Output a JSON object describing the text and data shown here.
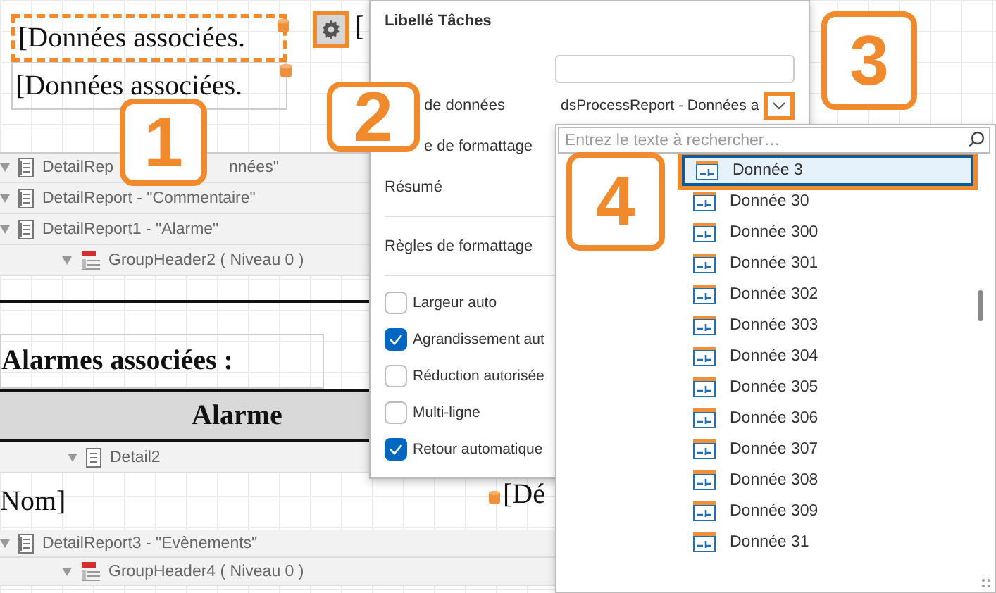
{
  "designer": {
    "fields": [
      {
        "text": "[Données associées.",
        "selected": true
      },
      {
        "text": "[Données associées.",
        "selected": false
      }
    ],
    "clipped_field": "[",
    "bands": [
      {
        "kind": "detail_report",
        "label": "DetailRep",
        "label_after": "nnées\""
      },
      {
        "kind": "detail_report",
        "label": "DetailReport - \"Commentaire\""
      },
      {
        "kind": "detail_report",
        "label": "DetailReport1 - \"Alarme\""
      },
      {
        "kind": "group_header",
        "label": "GroupHeader2 ( Niveau 0 )"
      }
    ],
    "section_title": "Alarmes associées :",
    "table_header": "Alarme",
    "detail_band": {
      "kind": "detail",
      "label": "Detail2"
    },
    "detail_fields": [
      "Nom]",
      "[Dé"
    ],
    "bottom_bands": [
      {
        "kind": "detail_report",
        "label": "DetailReport3 - \"Evènements\""
      },
      {
        "kind": "group_header",
        "label": "GroupHeader4 ( Niveau 0 )"
      }
    ]
  },
  "panel": {
    "title": "Libellé Tâches",
    "rows": [
      {
        "kind": "input"
      },
      {
        "kind": "select",
        "label": "de données",
        "value": "dsProcessReport - Données a"
      },
      {
        "kind": "clipped",
        "label": "e de formattage"
      },
      {
        "kind": "group",
        "label": "Résumé"
      },
      {
        "kind": "group",
        "label": "Règles de formattage"
      }
    ],
    "options": [
      {
        "label": "Largeur auto",
        "checked": false
      },
      {
        "label": "Agrandissement aut",
        "checked": true
      },
      {
        "label": "Réduction autorisée",
        "checked": false
      },
      {
        "label": "Multi-ligne",
        "checked": false
      },
      {
        "label": "Retour automatique",
        "checked": true
      }
    ]
  },
  "dropdown": {
    "placeholder": "Entrez le texte à rechercher…",
    "items": [
      {
        "label": "Donnée 3",
        "selected": true
      },
      {
        "label": "Donnée 30",
        "selected": false
      },
      {
        "label": "Donnée 300",
        "selected": false
      },
      {
        "label": "Donnée 301",
        "selected": false
      },
      {
        "label": "Donnée 302",
        "selected": false
      },
      {
        "label": "Donnée 303",
        "selected": false
      },
      {
        "label": "Donnée 304",
        "selected": false
      },
      {
        "label": "Donnée 305",
        "selected": false
      },
      {
        "label": "Donnée 306",
        "selected": false
      },
      {
        "label": "Donnée 307",
        "selected": false
      },
      {
        "label": "Donnée 308",
        "selected": false
      },
      {
        "label": "Donnée 309",
        "selected": false
      },
      {
        "label": "Donnée 31",
        "selected": false
      }
    ]
  },
  "callouts": [
    "1",
    "2",
    "3",
    "4"
  ]
}
